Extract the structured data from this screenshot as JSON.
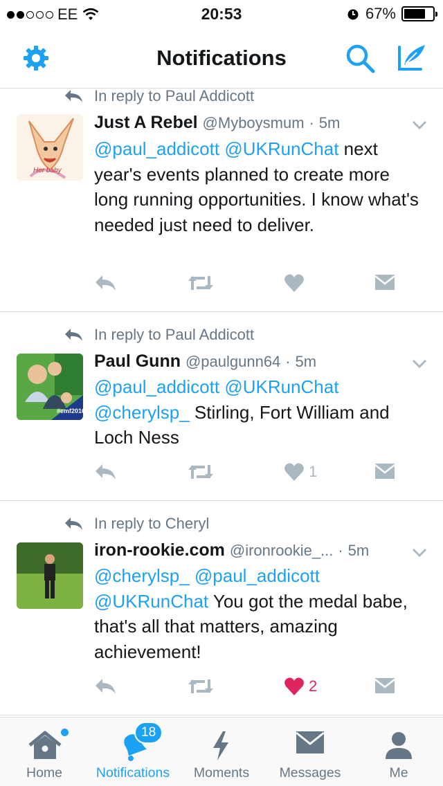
{
  "status_bar": {
    "carrier": "EE",
    "time": "20:53",
    "battery": "67%"
  },
  "nav": {
    "title": "Notifications"
  },
  "tweets": [
    {
      "reply_to": "In reply to Paul Addicott",
      "name": "Just A Rebel",
      "handle": "@Myboysmum",
      "sep": "·",
      "time": "5m",
      "body": [
        {
          "t": "@paul_addicott",
          "m": true
        },
        {
          "t": " ",
          "m": false
        },
        {
          "t": "@UKRunChat",
          "m": true
        },
        {
          "t": " next year's events planned to create more long running opportunities. I know what's needed just need to deliver.",
          "m": false
        }
      ],
      "avatar_text": "Her baby",
      "likes": "",
      "liked": false
    },
    {
      "reply_to": "In reply to Paul Addicott",
      "name": "Paul Gunn",
      "handle": "@paulgunn64",
      "sep": "·",
      "time": "5m",
      "body": [
        {
          "t": "@paul_addicott",
          "m": true
        },
        {
          "t": " ",
          "m": false
        },
        {
          "t": "@UKRunChat",
          "m": true
        },
        {
          "t": " ",
          "m": false
        },
        {
          "t": "@cherylsp_",
          "m": true
        },
        {
          "t": " Stirling, Fort William and Loch Ness",
          "m": false
        }
      ],
      "avatar_text": "#emf2016",
      "likes": "1",
      "liked": false
    },
    {
      "reply_to": "In reply to Cheryl",
      "name": "iron-rookie.com",
      "handle": "@ironrookie_...",
      "sep": "·",
      "time": "5m",
      "body": [
        {
          "t": "@cherylsp_",
          "m": true
        },
        {
          "t": " ",
          "m": false
        },
        {
          "t": "@paul_addicott",
          "m": true
        },
        {
          "t": " ",
          "m": false
        },
        {
          "t": "@UKRunChat",
          "m": true
        },
        {
          "t": " You got the medal babe, that's all that matters, amazing achievement!",
          "m": false
        }
      ],
      "avatar_text": "",
      "likes": "2",
      "liked": true
    }
  ],
  "tabs": [
    {
      "label": "Home",
      "icon": "home-icon",
      "active": false
    },
    {
      "label": "Notifications",
      "icon": "bell-icon",
      "active": true,
      "badge": "18"
    },
    {
      "label": "Moments",
      "icon": "lightning-icon",
      "active": false
    },
    {
      "label": "Messages",
      "icon": "envelope-icon",
      "active": false
    },
    {
      "label": "Me",
      "icon": "person-icon",
      "active": false
    }
  ],
  "colors": {
    "accent": "#1da1f2",
    "text": "#14171a",
    "muted": "#657786",
    "icon_muted": "#aab8c2",
    "like": "#e0245e"
  }
}
